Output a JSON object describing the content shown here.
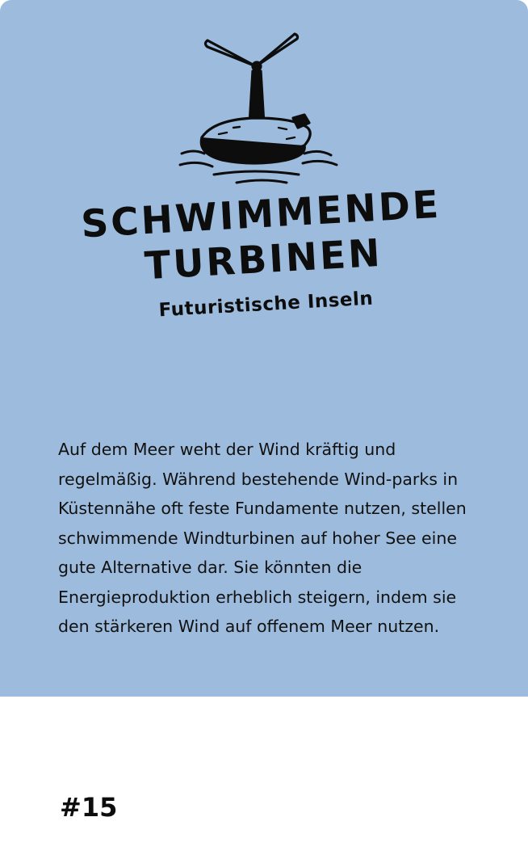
{
  "card": {
    "title_line1": "SCHWIMMENDE",
    "title_line2": "TURBINEN",
    "subtitle": "Futuristische Inseln",
    "body": "Auf dem Meer weht der Wind kräftig und regelmäßig. Während bestehende Wind-parks in Küstennähe oft feste Fundamente nutzen, stellen schwimmende Windturbinen auf hoher See eine gute Alternative dar. Sie könnten die Energieproduktion erheblich steigern, indem sie den stärkeren Wind auf offenem Meer nutzen.",
    "number": "#15",
    "illustration_icon": "floating-wind-turbine-icon",
    "colors": {
      "card_background": "#9dbcdd",
      "ink": "#0d0d0d",
      "page_background": "#ffffff"
    }
  }
}
